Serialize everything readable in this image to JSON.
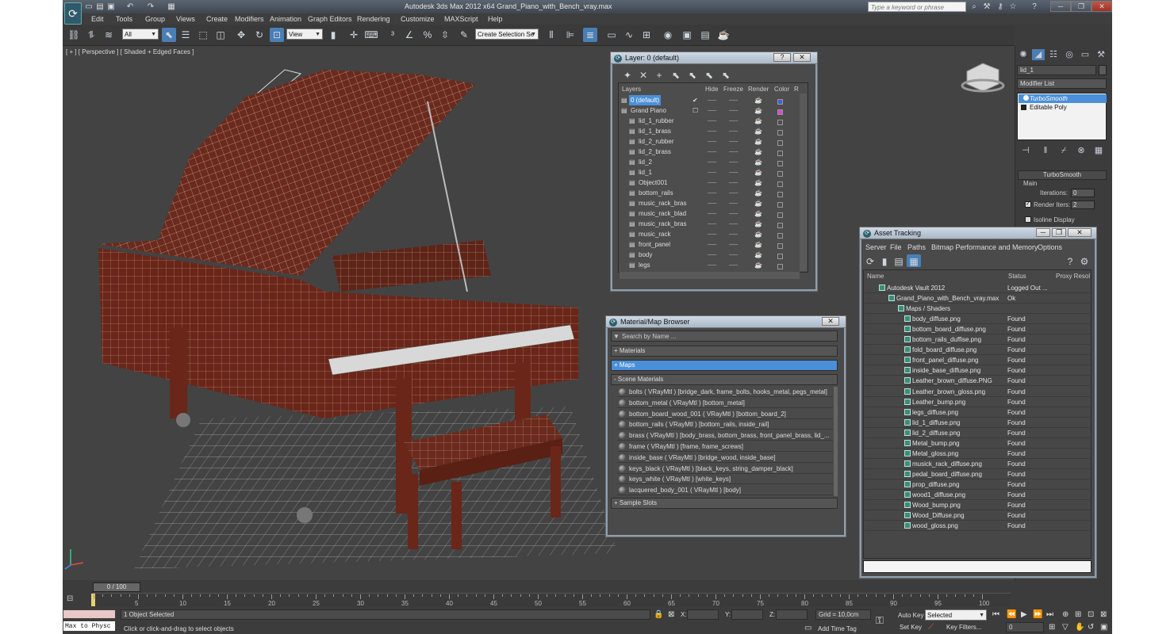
{
  "window": {
    "title": "Autodesk 3ds Max  2012 x64     Grand_Piano_with_Bench_vray.max",
    "search_placeholder": "Type a keyword or phrase"
  },
  "menu": [
    "Edit",
    "Tools",
    "Group",
    "Views",
    "Create",
    "Modifiers",
    "Animation",
    "Graph Editors",
    "Rendering",
    "Customize",
    "MAXScript",
    "Help"
  ],
  "toolbar": {
    "selection_filter": "All",
    "ref_coord": "View",
    "named_selection": "Create Selection Se"
  },
  "viewport": {
    "label": "[ + ] [ Perspective ] [ Shaded + Edged Faces ]"
  },
  "command_panel": {
    "object_name": "lid_1",
    "modifier_list": "Modifier List",
    "stack": [
      "TurboSmooth",
      "Editable Poly"
    ],
    "rollout_title": "TurboSmooth",
    "group_main": "Main",
    "iterations_label": "Iterations:",
    "iterations_value": "0",
    "render_iters_label": "Render Iters:",
    "render_iters_value": "2",
    "isoline_label": "Isoline Display"
  },
  "layer_dialog": {
    "title": "Layer: 0 (default)",
    "columns": [
      "Layers",
      "Hide",
      "Freeze",
      "Render",
      "Color",
      "R"
    ],
    "rows": [
      {
        "name": "0 (default)",
        "level": 0,
        "selected": true,
        "color": "#4a5ad8"
      },
      {
        "name": "Grand Piano",
        "level": 0,
        "selected": false,
        "color": "#d84ad0"
      },
      {
        "name": "lid_1_rubber",
        "level": 1,
        "selected": false,
        "color": ""
      },
      {
        "name": "lid_1_brass",
        "level": 1,
        "selected": false,
        "color": ""
      },
      {
        "name": "lid_2_rubber",
        "level": 1,
        "selected": false,
        "color": ""
      },
      {
        "name": "lid_2_brass",
        "level": 1,
        "selected": false,
        "color": ""
      },
      {
        "name": "lid_2",
        "level": 1,
        "selected": false,
        "color": ""
      },
      {
        "name": "lid_1",
        "level": 1,
        "selected": false,
        "color": ""
      },
      {
        "name": "Object001",
        "level": 1,
        "selected": false,
        "color": ""
      },
      {
        "name": "bottom_rails",
        "level": 1,
        "selected": false,
        "color": ""
      },
      {
        "name": "music_rack_bras",
        "level": 1,
        "selected": false,
        "color": ""
      },
      {
        "name": "music_rack_blad",
        "level": 1,
        "selected": false,
        "color": ""
      },
      {
        "name": "music_rack_bras",
        "level": 1,
        "selected": false,
        "color": ""
      },
      {
        "name": "music_rack",
        "level": 1,
        "selected": false,
        "color": ""
      },
      {
        "name": "front_panel",
        "level": 1,
        "selected": false,
        "color": ""
      },
      {
        "name": "body",
        "level": 1,
        "selected": false,
        "color": ""
      },
      {
        "name": "legs",
        "level": 1,
        "selected": false,
        "color": ""
      }
    ]
  },
  "material_browser": {
    "title": "Material/Map Browser",
    "search_placeholder": "Search by Name ...",
    "groups": [
      "+ Materials",
      "+ Maps",
      "- Scene Materials"
    ],
    "scene_materials": [
      "bolts  ( VRayMtl ) [bridge_dark, frame_bolts, hooks_metal, pegs_metal]",
      "bottom_metal  ( VRayMtl ) [bottom_metal]",
      "bottom_board_wood_001  ( VRayMtl ) [bottom_board_2]",
      "bottom_rails  ( VRayMtl ) [bottom_rails, inside_rail]",
      "brass  ( VRayMtl ) [body_brass, bottom_brass, front_panel_brass, lid_...",
      "frame  ( VRayMtl ) [frame, frame_screws]",
      "inside_base  ( VRayMtl ) [bridge_wood, inside_base]",
      "keys_black  ( VRayMtl ) [black_keys, string_damper_black]",
      "keys_white  ( VRayMtl ) [white_keys]",
      "lacquered_body_001  ( VRayMtl ) [body]"
    ],
    "sample_slots": "+ Sample Slots"
  },
  "asset_tracking": {
    "title": "Asset Tracking",
    "menu": [
      "Server",
      "File",
      "Paths",
      "Bitmap Performance and Memory",
      "Options"
    ],
    "columns": [
      "Name",
      "Status",
      "Proxy Resol"
    ],
    "rows": [
      {
        "name": "Autodesk Vault 2012",
        "status": "Logged Out ...",
        "level": 0
      },
      {
        "name": "Grand_Piano_with_Bench_vray.max",
        "status": "Ok",
        "level": 1
      },
      {
        "name": "Maps / Shaders",
        "status": "",
        "level": 2
      },
      {
        "name": "body_diffuse.png",
        "status": "Found",
        "level": 3
      },
      {
        "name": "bottom_board_diffuse.png",
        "status": "Found",
        "level": 3
      },
      {
        "name": "bottom_rails_duffise.png",
        "status": "Found",
        "level": 3
      },
      {
        "name": "fold_board_diffuse.png",
        "status": "Found",
        "level": 3
      },
      {
        "name": "front_panel_diffuse.png",
        "status": "Found",
        "level": 3
      },
      {
        "name": "inside_base_diffuse.png",
        "status": "Found",
        "level": 3
      },
      {
        "name": "Leather_brown_diffuse.PNG",
        "status": "Found",
        "level": 3
      },
      {
        "name": "Leather_brown_gloss.png",
        "status": "Found",
        "level": 3
      },
      {
        "name": "Leather_bump.png",
        "status": "Found",
        "level": 3
      },
      {
        "name": "legs_diffuse.png",
        "status": "Found",
        "level": 3
      },
      {
        "name": "lid_1_diffuse.png",
        "status": "Found",
        "level": 3
      },
      {
        "name": "lid_2_diffuse.png",
        "status": "Found",
        "level": 3
      },
      {
        "name": "Metal_bump.png",
        "status": "Found",
        "level": 3
      },
      {
        "name": "Metal_gloss.png",
        "status": "Found",
        "level": 3
      },
      {
        "name": "musick_rack_diffuse.png",
        "status": "Found",
        "level": 3
      },
      {
        "name": "pedal_board_diffuse.png",
        "status": "Found",
        "level": 3
      },
      {
        "name": "prop_diffuse.png",
        "status": "Found",
        "level": 3
      },
      {
        "name": "wood1_diffuse.png",
        "status": "Found",
        "level": 3
      },
      {
        "name": "Wood_bump.png",
        "status": "Found",
        "level": 3
      },
      {
        "name": "Wood_Diffuse.png",
        "status": "Found",
        "level": 3
      },
      {
        "name": "wood_gloss.png",
        "status": "Found",
        "level": 3
      }
    ]
  },
  "timeline": {
    "frame_display": "0 / 100",
    "ticks": [
      "5",
      "10",
      "15",
      "20",
      "25",
      "30",
      "35",
      "40",
      "45",
      "50",
      "55",
      "60",
      "65",
      "70",
      "75",
      "80",
      "85",
      "90",
      "95",
      "100"
    ]
  },
  "status_bar": {
    "maxscript": "Max to Physc",
    "selected": "1 Object Selected",
    "prompt": "Click or click-and-drag to select objects",
    "x_label": "X:",
    "y_label": "Y:",
    "z_label": "Z:",
    "grid": "Grid = 10,0cm",
    "add_time_tag": "Add Time Tag",
    "auto_key": "Auto Key",
    "set_key": "Set Key",
    "selected_combo": "Selected",
    "key_filters": "Key Filters...",
    "frame_value": "0"
  },
  "colors": {
    "accent": "#4a8fd8",
    "wood": "#6b2a1c",
    "found": "#e4e4e4"
  }
}
